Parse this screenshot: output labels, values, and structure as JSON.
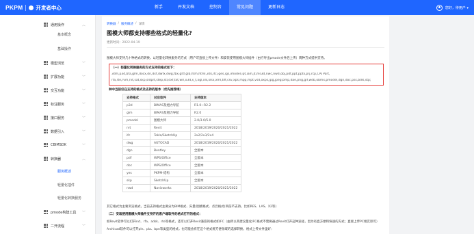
{
  "header": {
    "logo_text": "PKPM",
    "title": "开发者中心",
    "nav": [
      {
        "label": "新手"
      },
      {
        "label": "开发文档"
      },
      {
        "label": "控制台"
      },
      {
        "label": "常见问题"
      },
      {
        "label": "更新日志"
      }
    ],
    "active_nav": "常见问题",
    "user_name": "您好，待用户 ▾",
    "accent_color": "#1f66ff"
  },
  "sidebar": {
    "items": [
      {
        "label": "通用操作",
        "icon": "grid-icon",
        "expanded": true
      },
      {
        "label": "基本概念",
        "icon": "",
        "sub": true
      },
      {
        "label": "基础操作",
        "icon": "",
        "sub": true
      },
      {
        "label": "模型浏览",
        "icon": "grid-icon"
      },
      {
        "label": "扩展功能",
        "icon": "grid-icon"
      },
      {
        "label": "交互功能",
        "icon": "grid-icon"
      },
      {
        "label": "标注服务",
        "icon": "grid-icon"
      },
      {
        "label": "接口服务",
        "icon": "grid-icon"
      },
      {
        "label": "数据引入",
        "icon": "grid-icon"
      },
      {
        "label": "CBIMSDK",
        "icon": "grid-icon"
      },
      {
        "label": "转换器",
        "icon": "grid-icon",
        "expanded": true
      },
      {
        "label": "服务概述",
        "icon": "",
        "sub": true,
        "active": true
      },
      {
        "label": "轻量化插件",
        "icon": "",
        "sub": true
      },
      {
        "label": "轻量化转换服务",
        "icon": "",
        "sub": true
      },
      {
        "label": "pmode构建工具",
        "icon": "grid-icon"
      },
      {
        "label": "二开流程",
        "icon": "grid-icon"
      }
    ]
  },
  "breadcrumb": {
    "items": [
      "转换器",
      "服务概述",
      "详情"
    ],
    "separator": "/"
  },
  "article": {
    "title": "图模大师都支持哪些格式的轻量化?",
    "updated": "更新时间：2022-04-19",
    "intro": "图模大师支持几十种格式的转换，以轻量化转换服务的方式（用户可直接上传文件）和安装使用图模大师插件（由行导出pmode文件后上传）两种方式提供支持。",
    "box_heading": "（一）轻量化转换服务的方式支持的格式如下：",
    "box_line1": "3dm,p3d,bfa,glm,docx,dn,dxf,dwfx,dwg,fbx,gltf,glb,htm,html,3ds,ifc,iges,igs,imodel,ipt,iam,jt,ms3d,nwc,nwd,obj,pdf,ppt,pptx,prj,rcp,CATPart,",
    "box_line2": "rfa,rte,rvm,rvt,sat,skp,sldprt,step,stl,dxf,txt,wrl,x3d,x_t,xgl,xls,xlsx,xml,tiff,csv,xps,mpp,mpt,vsd,oxps,jpg,jpeg,bmp,dae,png,gif,wdb,obmx,pmodel,dgn,doc,pss,bdls,stp;",
    "section2": "（二）使用图模大师插件导出方式支持的格式如下：",
    "table_intro": "种中当前仅在支持的格式及支持的版本（优先推荐绿）"
  },
  "format_table": {
    "headers": [
      "支持格式",
      "对应软件",
      "支持版本"
    ],
    "rows": [
      [
        "p3d",
        "BIMAS及相力导航",
        "R1.0~R2.2"
      ],
      [
        "glm",
        "BIMAS及相力导航",
        "R2.0"
      ],
      [
        "pmodel",
        "图模大师",
        "2.0/3.0/5.0"
      ],
      [
        "rvt",
        "Revit",
        "2018/2019/2020/2021/2022"
      ],
      [
        "ifc",
        "Tekla/SketchUp",
        "2x2/2x3/2x4"
      ],
      [
        "dwg",
        "AUTOCAD",
        "2018/2019/2020/2021/2022"
      ],
      [
        "dgn",
        "Bentley",
        "全版本"
      ],
      [
        "pdf",
        "WPS/Office",
        "全版本"
      ],
      [
        "doc",
        "WPS/Office",
        "全版本"
      ],
      [
        "yes",
        "PKPM-结构",
        "全版本"
      ],
      [
        "skp",
        "SketchUp",
        "全版本"
      ],
      [
        "nwd",
        "Navisworks",
        "2018/2019/2020/2021/2022"
      ]
    ]
  },
  "footer": {
    "note1": "其它格式为主要浏览格式，当前支持格式主要分为BIM格式、矢量/图模格式、点云格式(目前不支持，比如RES、LAS、X2等)",
    "section3": "（二）安装使用图模大师插件支持开的客户端软件的格式打开的格式：",
    "note2": "如Revit软件可以打开rvt、rfa、adsk、rte等格式，还可以打开Revit兼容的格式如IFC（由所以英建议量化IFC格式不需要通过Revit打开这种途径，因为有直方便和快速的方式；直接上传PC端实际可）",
    "note3": "Archicad软件可以打开pln、pla、bpn等类型的格式，也可能会有在这个格式要方便领域的选择转换，格式上传文件里好："
  }
}
